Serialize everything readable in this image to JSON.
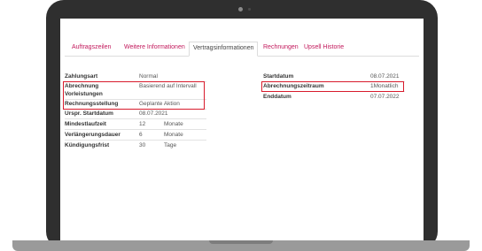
{
  "tabs": [
    {
      "label": "Auftragszeilen",
      "active": false
    },
    {
      "label": "Weitere Informationen",
      "active": false
    },
    {
      "label": "Vertragsinformationen",
      "active": true
    },
    {
      "label": "Rechnungen",
      "active": false
    },
    {
      "label": "Upsell Historie",
      "active": false
    }
  ],
  "left_fields": [
    {
      "label": "Zahlungsart",
      "value": "Normal",
      "unit": ""
    },
    {
      "label": "Abrechnung",
      "value": "Basierend auf Intervall",
      "unit": ""
    },
    {
      "label": "Vorleistungen",
      "value": "",
      "unit": ""
    },
    {
      "label": "Rechnungsstellung",
      "value": "Geplante Aktion",
      "unit": ""
    },
    {
      "label": "Urspr. Startdatum",
      "value": "08.07.2021",
      "unit": ""
    },
    {
      "label": "Mindestlaufzeit",
      "value": "12",
      "unit": "Monate"
    },
    {
      "label": "Verlängerungsdauer",
      "value": "6",
      "unit": "Monate"
    },
    {
      "label": "Kündigungsfrist",
      "value": "30",
      "unit": "Tage"
    }
  ],
  "right_fields": [
    {
      "label": "Startdatum",
      "value": "08.07.2021"
    },
    {
      "label": "Abrechnungszeitraum",
      "value": "1Monatlich"
    },
    {
      "label": "Enddatum",
      "value": "07.07.2022"
    }
  ],
  "colors": {
    "accent": "#c2185b",
    "highlight": "#d81b2c",
    "laptop_frame": "#2f2f2f",
    "laptop_base": "#9a9a9a"
  }
}
